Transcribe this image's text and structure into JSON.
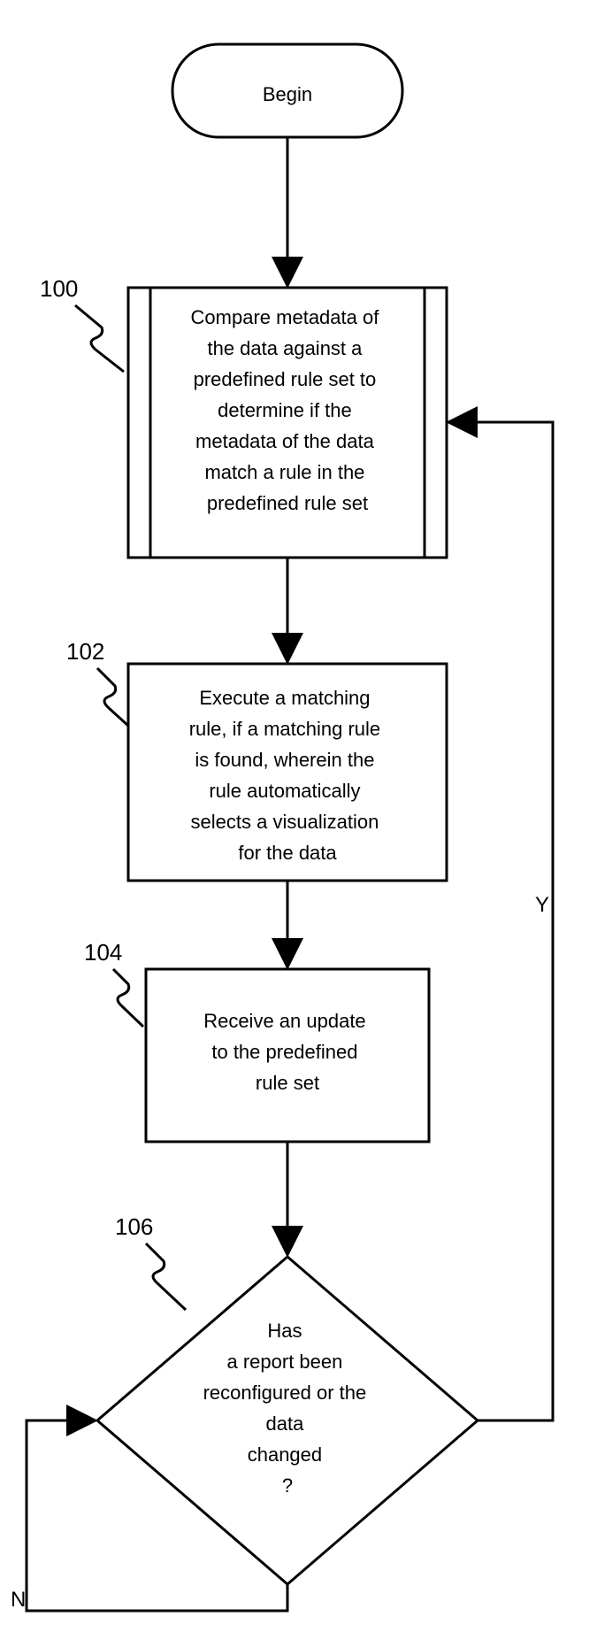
{
  "flow": {
    "begin": "Begin",
    "steps": [
      {
        "ref": "100",
        "text": "Compare metadata of the data against a predefined rule set to determine if the metadata of the data match a rule in the predefined rule set"
      },
      {
        "ref": "102",
        "text": "Execute a matching rule, if a matching rule is found, wherein the rule automatically selects a visualization for the data"
      },
      {
        "ref": "104",
        "text": "Receive an update to the predefined rule set"
      }
    ],
    "decision": {
      "ref": "106",
      "text": "Has a report been reconfigured or the data changed ?"
    },
    "branches": {
      "yes": "Y",
      "no": "N"
    }
  }
}
